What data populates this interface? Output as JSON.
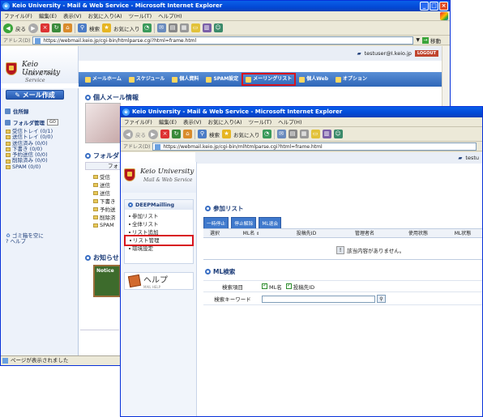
{
  "back_window": {
    "title": "Keio University - Mail & Web Service - Microsoft Internet Explorer",
    "menu": [
      "ファイル(F)",
      "編集(E)",
      "表示(V)",
      "お気に入り(A)",
      "ツール(T)",
      "ヘルプ(H)"
    ],
    "toolbar": {
      "back": "戻る",
      "search": "検索",
      "favorites": "お気に入り"
    },
    "address_label": "アドレス(D)",
    "address": "https://webmail.keio.jp/cgi-bin/htmlparse.cgi?html=frame.html",
    "go": "移動",
    "user": "testuser@I.keio.jp",
    "logout": "LOGOUT",
    "logo_name": "Keio University",
    "logo_sub": "Mail & Web Service",
    "nav": [
      "メールホーム",
      "スケジュール",
      "個人資料",
      "SPAM設定",
      "メーリングリスト",
      "個人Web",
      "オプション"
    ],
    "mail_compose": "メール作成",
    "sidebar_sections": {
      "addressbook": "住所録",
      "folder_mgmt": "フォルダ管理",
      "folder_badge": "GO"
    },
    "folders": [
      "受信トレイ (0/1)",
      "送信トレイ (0/0)",
      "送信済み (0/0)",
      "下書き (0/0)",
      "予約送信 (0/0)",
      "削除済み (0/0)",
      "SPAM (0/0)"
    ],
    "trash": "ゴミ箱を空に",
    "help": "ヘルプ",
    "personal_mail_info": "個人メール情報",
    "folder_section": "フォルダ",
    "folder_header": "フォ",
    "folder_rows": [
      "受信",
      "送信",
      "送信",
      "下書き",
      "予約送",
      "削除済",
      "SPAM"
    ],
    "notice_section": "お知らせ",
    "notice_label": "Notice",
    "status": "ページが表示されました"
  },
  "front_window": {
    "title": "Keio University - Mail & Web Service - Microsoft Internet Explorer",
    "menu": [
      "ファイル(F)",
      "編集(E)",
      "表示(V)",
      "お気に入り(A)",
      "ツール(T)",
      "ヘルプ(H)"
    ],
    "toolbar": {
      "back": "戻る",
      "search": "検索",
      "favorites": "お気に入り"
    },
    "address_label": "アドレス(D)",
    "address": "https://webmail.keio.jp/cgi-bin/mlhtmlparse.cgi?html=frame.html",
    "user": "testu",
    "logo_name": "Keio University",
    "logo_sub": "Mail & Web Service",
    "deep_title": "DEEPMailling",
    "deep_items": [
      "参加リスト",
      "全体リスト",
      "リスト追加",
      "リスト管理",
      "環境設定"
    ],
    "help": "ヘルプ",
    "help_sub": "MAIL HELP",
    "list_title": "参加リスト",
    "buttons": [
      "一時停止",
      "停止解除",
      "ML退会"
    ],
    "columns": [
      "選択",
      "ML名",
      "投稿先ID",
      "管理者名",
      "使用状態",
      "ML状態"
    ],
    "empty": "該当内容がありません。",
    "search_title": "ML検索",
    "search_item_label": "検索項目",
    "search_opt1": "ML名",
    "search_opt2": "投稿先ID",
    "search_keyword_label": "検索キーワード"
  }
}
